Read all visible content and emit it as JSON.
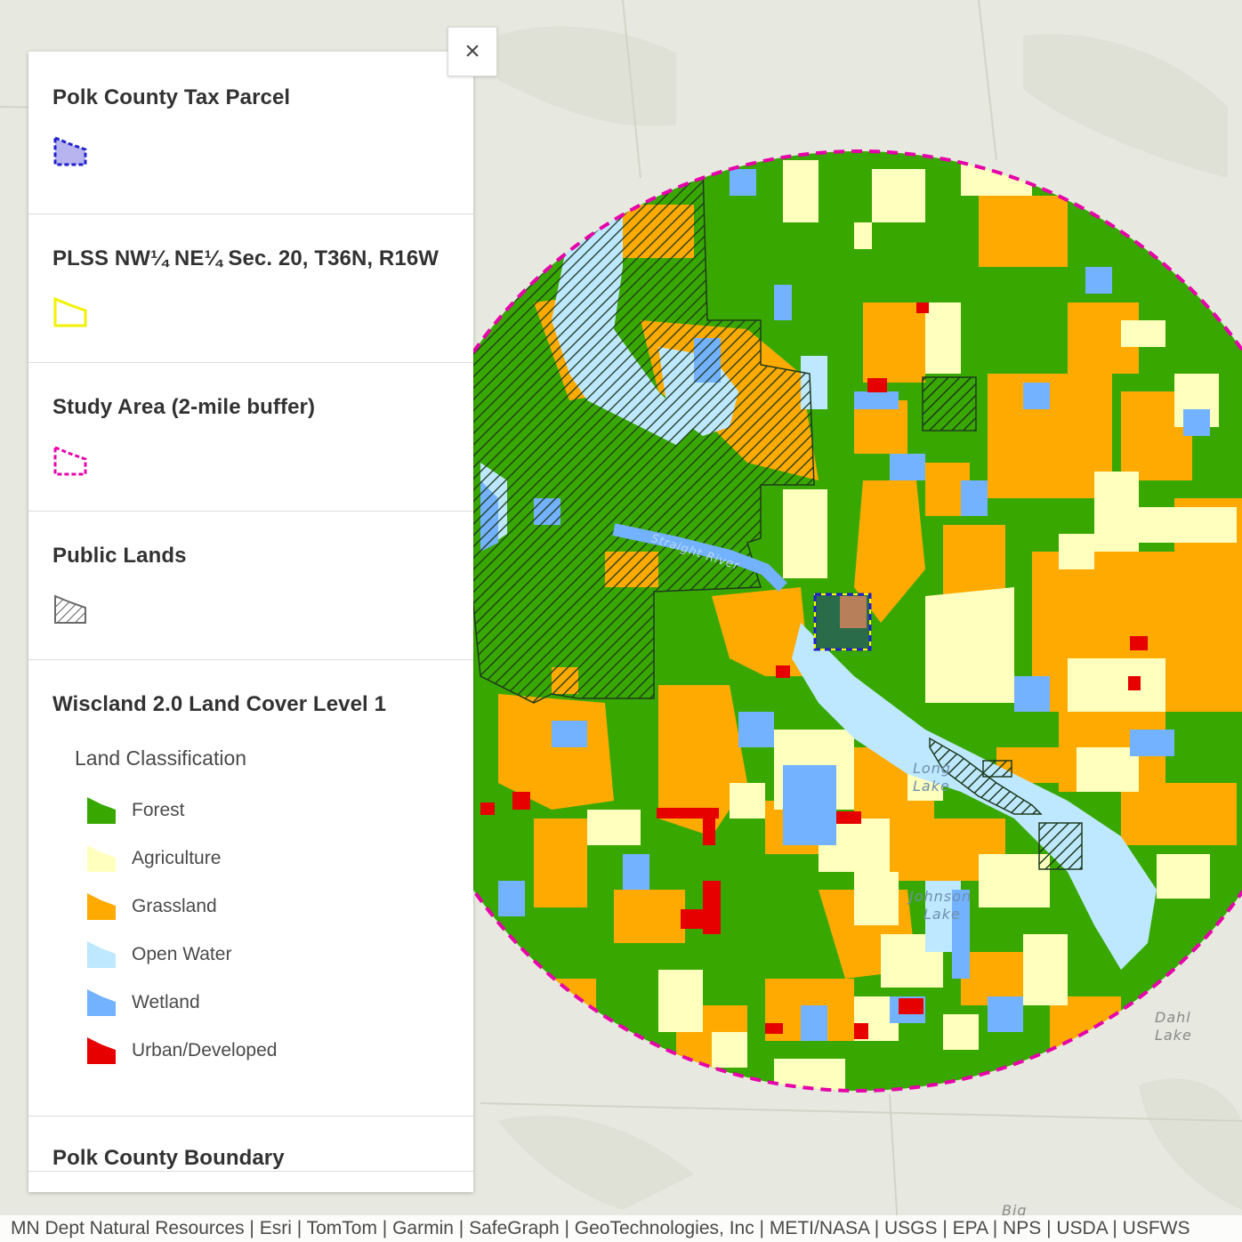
{
  "colors": {
    "forest": "#38a800",
    "agriculture": "#ffffbe",
    "grassland": "#ffaa00",
    "open_water": "#bee8ff",
    "wetland": "#73b2ff",
    "urban": "#e60000",
    "study_area": "#e600a9",
    "parcel": "#2020cc",
    "plss": "#ffff00",
    "basemap": "#e7e8df"
  },
  "legend": {
    "layers": [
      {
        "title": "Polk County Tax Parcel",
        "icon": "dashed-blue-polygon-icon"
      },
      {
        "title": "PLSS NW¼ NE¼ Sec. 20, T36N, R16W",
        "icon": "yellow-outline-polygon-icon"
      },
      {
        "title": "Study Area (2-mile buffer)",
        "icon": "dashed-magenta-polygon-icon"
      },
      {
        "title": "Public Lands",
        "icon": "hatched-polygon-icon"
      }
    ],
    "landcover": {
      "title": "Wiscland 2.0 Land Cover Level 1",
      "subtitle": "Land Classification",
      "classes": [
        {
          "label": "Forest",
          "color": "#38a800"
        },
        {
          "label": "Agriculture",
          "color": "#ffffbe"
        },
        {
          "label": "Grassland",
          "color": "#ffaa00"
        },
        {
          "label": "Open Water",
          "color": "#bee8ff"
        },
        {
          "label": "Wetland",
          "color": "#73b2ff"
        },
        {
          "label": "Urban/Developed",
          "color": "#e60000"
        }
      ]
    },
    "boundary": {
      "title": "Polk County Boundary"
    },
    "close_label": "×"
  },
  "map_labels": {
    "long_lake": [
      "Long",
      "Lake"
    ],
    "johnson_lake": [
      "Johnson",
      "Lake"
    ],
    "dahl_lake": [
      "Dahl",
      "Lake"
    ],
    "big": "Big",
    "river": "Straight River"
  },
  "attribution": "MN Dept Natural Resources | Esri | TomTom | Garmin | SafeGraph | GeoTechnologies, Inc | METI/NASA | USGS | EPA | NPS | USDA | USFWS"
}
